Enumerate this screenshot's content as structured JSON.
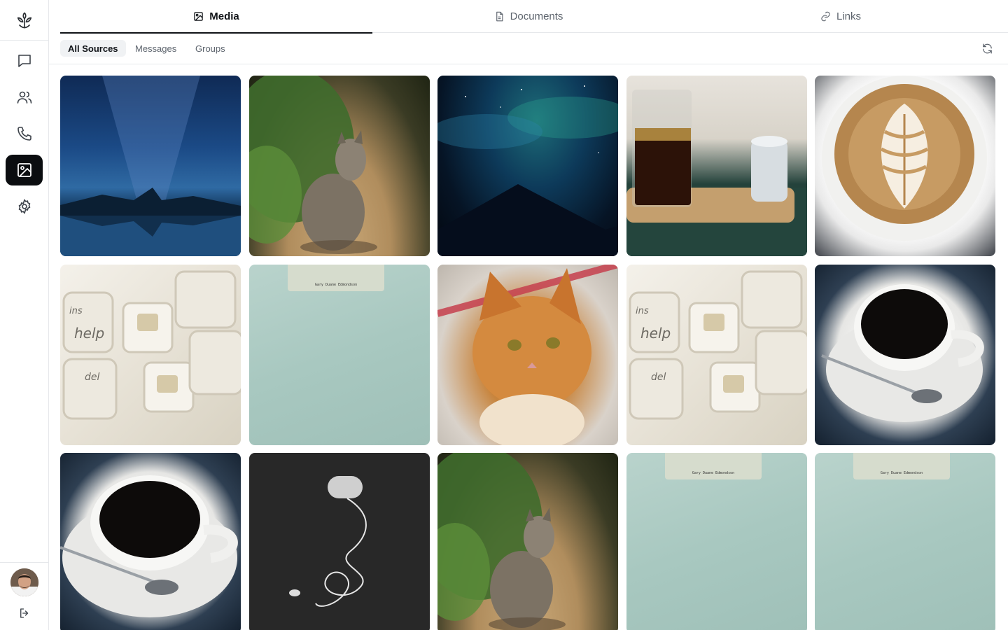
{
  "tabs": [
    {
      "label": "Media",
      "icon": "image-icon",
      "active": true
    },
    {
      "label": "Documents",
      "icon": "document-icon",
      "active": false
    },
    {
      "label": "Links",
      "icon": "link-icon",
      "active": false
    }
  ],
  "filters": [
    {
      "label": "All Sources",
      "active": true
    },
    {
      "label": "Messages",
      "active": false
    },
    {
      "label": "Groups",
      "active": false
    }
  ],
  "sidebar": {
    "items": [
      {
        "name": "chats",
        "icon": "chat-bubble-icon",
        "active": false
      },
      {
        "name": "contacts",
        "icon": "users-icon",
        "active": false
      },
      {
        "name": "calls",
        "icon": "phone-icon",
        "active": false
      },
      {
        "name": "media",
        "icon": "image-icon",
        "active": true
      },
      {
        "name": "settings",
        "icon": "gear-icon",
        "active": false
      }
    ]
  },
  "media": [
    {
      "subject": "milky-way-mountain-lake"
    },
    {
      "subject": "tabby-cat-in-sun"
    },
    {
      "subject": "aurora-night-sky"
    },
    {
      "subject": "pour-over-coffee"
    },
    {
      "subject": "latte-art"
    },
    {
      "subject": "keyboard-keys"
    },
    {
      "subject": "paper-folder",
      "caption": "Gary Duane Edmondson"
    },
    {
      "subject": "ginger-cat"
    },
    {
      "subject": "keyboard-keys"
    },
    {
      "subject": "black-coffee-cup"
    },
    {
      "subject": "black-coffee-cup"
    },
    {
      "subject": "earbud-cable"
    },
    {
      "subject": "tabby-cat-in-sun"
    },
    {
      "subject": "paper-folder",
      "caption": "Gary Duane Edmondson"
    },
    {
      "subject": "paper-folder",
      "caption": "Gary Duane Edmondson"
    }
  ],
  "colors": {
    "accent": "#0b0d10",
    "border": "#e6e8eb",
    "muted": "#5d646d"
  }
}
